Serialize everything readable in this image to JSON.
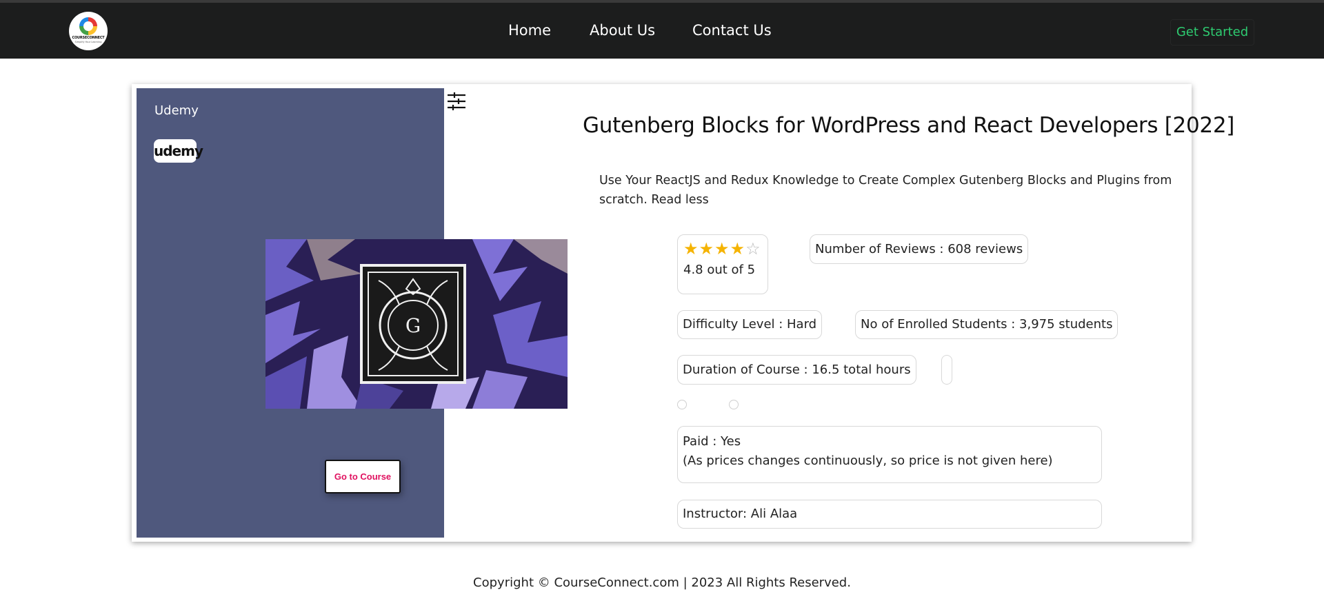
{
  "nav": {
    "logo_brand": "COURSECONNECT",
    "logo_tagline": "Simplify Your Learning",
    "links": [
      "Home",
      "About Us",
      "Contact Us"
    ],
    "cta_label": "Get Started"
  },
  "course": {
    "provider": "Udemy",
    "provider_logo_text": "udemy",
    "title": "Gutenberg Blocks for WordPress and React Developers [2022]",
    "description": "Use Your ReactJS and Redux Knowledge to Create Complex Gutenberg Blocks and Plugins from scratch. Read less",
    "image_glyph": "G",
    "rating_stars": 4,
    "rating_max_stars": 5,
    "rating_text": "4.8 out of 5",
    "reviews": "Number of Reviews : 608 reviews",
    "difficulty": "Difficulty Level : Hard",
    "enrolled": "No of Enrolled Students : 3,975 students",
    "duration": "Duration of Course : 16.5 total hours",
    "paid_line1": "Paid : Yes",
    "paid_line2": "(As prices changes continuously, so price is not given here)",
    "instructor": "Instructor: Ali Alaa",
    "go_button": "Go to Course"
  },
  "footer": {
    "copyright": "Copyright © CourseConnect.com | 2023 All Rights Reserved."
  },
  "colors": {
    "navbar_bg": "#1c1d1d",
    "cta_text": "#2ecc71",
    "left_panel_bg": "#4f587d",
    "button_text": "#e0115f",
    "star": "#f5b301"
  },
  "icons": {
    "menu": "sliders-menu-icon",
    "star": "star-icon"
  }
}
